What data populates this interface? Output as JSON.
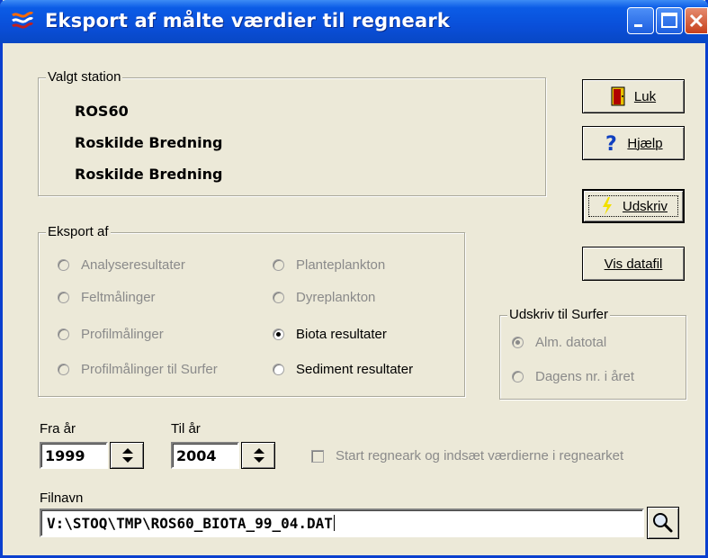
{
  "window": {
    "title": "Eksport af målte værdier til regneark"
  },
  "station": {
    "group_label": "Valgt station",
    "code": "ROS60",
    "name1": "Roskilde Bredning",
    "name2": "Roskilde Bredning"
  },
  "buttons": {
    "luk": "Luk",
    "hjaelp": "Hjælp",
    "udskriv": "Udskriv",
    "vis_datafil": "Vis datafil"
  },
  "export": {
    "group_label": "Eksport af",
    "options": [
      {
        "label": "Analyseresultater",
        "enabled": false,
        "checked": false
      },
      {
        "label": "Feltmålinger",
        "enabled": false,
        "checked": false
      },
      {
        "label": "Profilmålinger",
        "enabled": false,
        "checked": false
      },
      {
        "label": "Profilmålinger til Surfer",
        "enabled": false,
        "checked": false
      },
      {
        "label": "Planteplankton",
        "enabled": false,
        "checked": false
      },
      {
        "label": "Dyreplankton",
        "enabled": false,
        "checked": false
      },
      {
        "label": "Biota resultater",
        "enabled": true,
        "checked": true
      },
      {
        "label": "Sediment resultater",
        "enabled": true,
        "checked": false
      }
    ]
  },
  "surfer": {
    "group_label": "Udskriv til Surfer",
    "options": [
      {
        "label": "Alm. datotal",
        "enabled": false,
        "checked": true
      },
      {
        "label": "Dagens nr. i året",
        "enabled": false,
        "checked": false
      }
    ]
  },
  "years": {
    "from_label": "Fra år",
    "from_value": "1999",
    "to_label": "Til år",
    "to_value": "2004"
  },
  "start_excel": {
    "label": "Start regneark og indsæt værdierne i regnearket",
    "checked": false,
    "enabled": false
  },
  "file": {
    "label": "Filnavn",
    "value": "V:\\STOQ\\TMP\\ROS60_BIOTA_99_04.DAT"
  },
  "icons": {
    "title": "app-icon",
    "luk": "door-exit-icon",
    "hjaelp": "question-icon",
    "udskriv": "lightning-icon",
    "search": "magnifier-icon"
  }
}
